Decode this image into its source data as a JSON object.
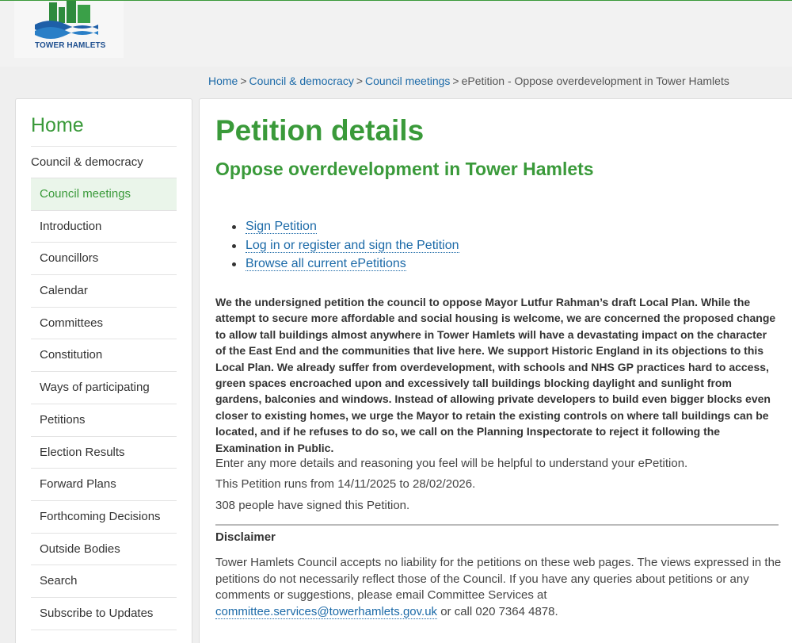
{
  "header": {
    "logo_text": "TOWER HAMLETS",
    "brand_green": "#3a9a3a",
    "brand_blue": "#1e4f8f"
  },
  "breadcrumb": {
    "items": [
      {
        "label": "Home"
      },
      {
        "label": "Council & democracy"
      },
      {
        "label": "Council meetings"
      }
    ],
    "separator": ">",
    "current": "ePetition - Oppose overdevelopment in Tower Hamlets"
  },
  "sidebar": {
    "home_label": "Home",
    "category_label": "Council & democracy",
    "items": [
      {
        "label": "Council meetings",
        "active": true
      },
      {
        "label": "Introduction"
      },
      {
        "label": "Councillors"
      },
      {
        "label": "Calendar"
      },
      {
        "label": "Committees"
      },
      {
        "label": "Constitution"
      },
      {
        "label": "Ways of participating"
      },
      {
        "label": "Petitions"
      },
      {
        "label": "Election Results"
      },
      {
        "label": "Forward Plans"
      },
      {
        "label": "Forthcoming Decisions"
      },
      {
        "label": "Outside Bodies"
      },
      {
        "label": "Search"
      },
      {
        "label": "Subscribe to Updates"
      }
    ]
  },
  "main": {
    "title": "Petition details",
    "subtitle": "Oppose overdevelopment in Tower Hamlets",
    "actions": [
      {
        "label": "Sign Petition"
      },
      {
        "label": "Log in or register and sign the Petition"
      },
      {
        "label": "Browse all current ePetitions"
      }
    ],
    "petition_text": "We the undersigned petition the council to oppose Mayor Lutfur Rahman’s draft Local Plan. While the attempt to secure more affordable and social housing is welcome, we are concerned the proposed change to allow tall buildings almost anywhere in Tower Hamlets will have a devastating impact on the character of the East End and the communities that live here. We support Historic England in its objections to this Local Plan. We already suffer from overdevelopment, with schools and NHS GP practices hard to access, green spaces encroached upon and excessively tall buildings blocking daylight and sunlight from gardens, balconies and windows. Instead of allowing private developers to build even bigger blocks even closer to existing homes, we urge the Mayor to retain the existing controls on where tall buildings can be located, and if he refuses to do so, we call on the Planning Inspectorate to reject it following the Examination in Public.",
    "more_details": "Enter any more details and reasoning you feel will be helpful to understand your ePetition.",
    "runs_text": "This Petition runs from 14/11/2025 to 28/02/2026.",
    "signatures_text": "308 people have signed this Petition.",
    "disclaimer_title": "Disclaimer",
    "disclaimer_text": "Tower Hamlets Council accepts no liability for the petitions on these web pages. The views expressed in the petitions do not necessarily reflect those of the Council. If you have any queries about petitions or any comments or suggestions, please email Committee Services at",
    "disclaimer_email": "committee.services@towerhamlets.gov.uk",
    "disclaimer_suffix": " or call 020 7364 4878."
  }
}
